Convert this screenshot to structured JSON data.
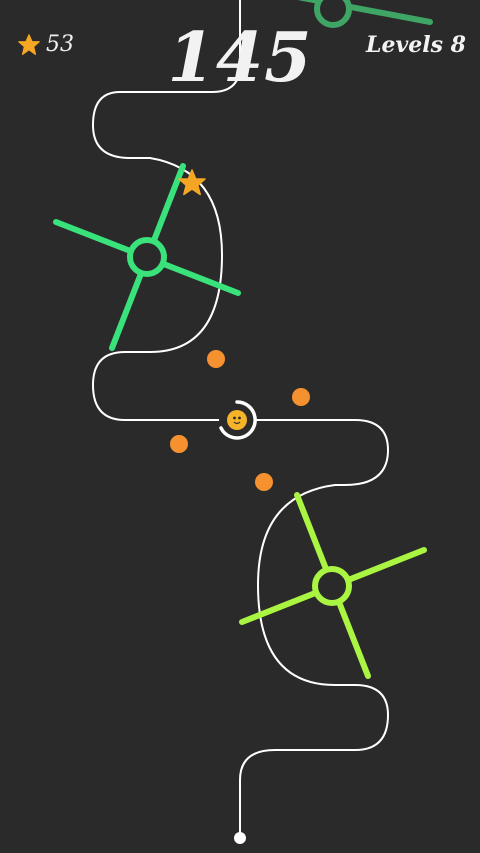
{
  "hud": {
    "stars": "53",
    "score": "145",
    "level": "Levels 8"
  },
  "colors": {
    "background": "#2a2a2a",
    "track": "#ffffff",
    "spinner_top": "#3fa565",
    "spinner_mid": "#39e27a",
    "spinner_low": "#a9f542",
    "dot": "#f5922f",
    "star": "#f5a623",
    "ball": "#f5b32a"
  },
  "icons": {
    "star_counter": "star-icon",
    "star_pickup": "star-icon",
    "player": "ball-icon"
  }
}
